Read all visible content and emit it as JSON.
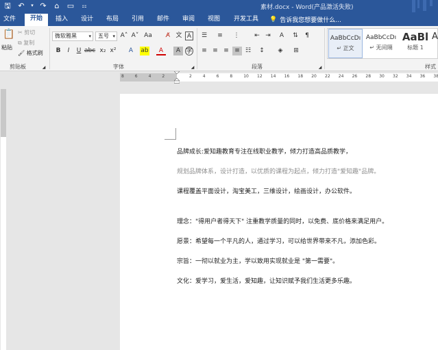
{
  "title_bar": {
    "title": "素材.docx - Word(产品激活失败)"
  },
  "tabs": [
    {
      "label": "文件"
    },
    {
      "label": "开始"
    },
    {
      "label": "插入"
    },
    {
      "label": "设计"
    },
    {
      "label": "布局"
    },
    {
      "label": "引用"
    },
    {
      "label": "邮件"
    },
    {
      "label": "审阅"
    },
    {
      "label": "视图"
    },
    {
      "label": "开发工具"
    }
  ],
  "tell_me": "告诉我您想要做什么...",
  "clipboard": {
    "paste": "粘贴",
    "cut": "剪切",
    "copy": "复制",
    "format_painter": "格式刷",
    "group_label": "剪贴板"
  },
  "font": {
    "name": "微软雅黑",
    "size": "五号",
    "grow": "A˄",
    "shrink": "A˅",
    "change_case": "Aa",
    "group_label": "字体"
  },
  "paragraph": {
    "group_label": "段落"
  },
  "styles": {
    "items": [
      {
        "sample": "AaBbCcDı",
        "name": "↵ 正文"
      },
      {
        "sample": "AaBbCcDı",
        "name": "↵ 无间隔"
      },
      {
        "sample": "AaBl",
        "name": "标题 1"
      },
      {
        "sample": "A",
        "name": ""
      }
    ],
    "group_label": "样式"
  },
  "ruler": {
    "ticks": [
      "8",
      "6",
      "4",
      "2",
      "",
      "2",
      "4",
      "6",
      "8",
      "10",
      "12",
      "14",
      "16",
      "18",
      "20",
      "22",
      "24",
      "26",
      "28",
      "30",
      "32",
      "34",
      "36",
      "38"
    ]
  },
  "document": {
    "paragraphs": [
      {
        "text": "品牌成长:爱知趣教育专注在线职业教学，倾力打造高品质教学，",
        "faded": false
      },
      {
        "text": "规划品牌体系，设计打造，以优质的课程为起点，倾力打造\"爱知趣\"品牌。",
        "faded": true
      },
      {
        "text": "课程覆盖平面设计，淘宝美工，三维设计，绘画设计，办公软件。",
        "faded": false
      },
      {
        "text": "理念：\"得用户者得天下\" 注重教学质量的同时，以免费、底价格来满足用户。",
        "faded": false
      },
      {
        "text": "愿景：希望每一个平凡的人，通过学习，可以给世界带来不凡，添加色彩。",
        "faded": false
      },
      {
        "text": "宗旨：一彻以就业为主，学以致用实现就业是 \"第一需要\"。",
        "faded": false
      },
      {
        "text": "文化：爱学习，爱生活，爱知趣，让知识赋予我们生活更多乐趣。",
        "faded": false
      }
    ]
  }
}
